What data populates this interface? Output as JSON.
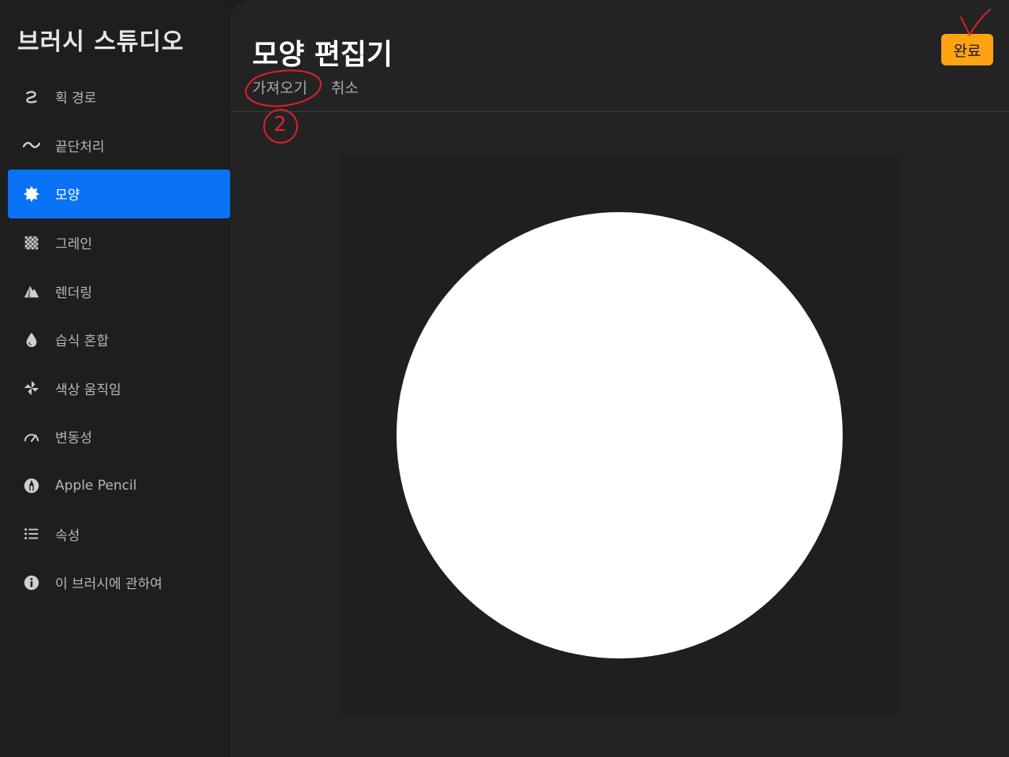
{
  "sidebar": {
    "title": "브러시 스튜디오",
    "items": [
      {
        "label": "획 경로",
        "icon": "stroke-path-icon"
      },
      {
        "label": "끝단처리",
        "icon": "taper-wave-icon"
      },
      {
        "label": "모양",
        "icon": "shape-star-icon",
        "active": true
      },
      {
        "label": "그레인",
        "icon": "grain-checker-icon"
      },
      {
        "label": "렌더링",
        "icon": "rendering-mountain-icon"
      },
      {
        "label": "습식 혼합",
        "icon": "wet-mix-drop-icon"
      },
      {
        "label": "색상 움직임",
        "icon": "color-dynamics-pinwheel-icon"
      },
      {
        "label": "변동성",
        "icon": "dynamics-gauge-icon"
      },
      {
        "label": "Apple Pencil",
        "icon": "apple-pencil-icon"
      },
      {
        "label": "속성",
        "icon": "properties-list-icon"
      },
      {
        "label": "이 브러시에 관하여",
        "icon": "info-icon"
      }
    ]
  },
  "main": {
    "title": "모양 편집기",
    "subnav": {
      "import": "가져오기",
      "cancel": "취소"
    },
    "done_label": "완료"
  },
  "annotations": {
    "step_number": "2",
    "colors": {
      "red_marker": "#e0202c"
    }
  },
  "colors": {
    "accent_blue": "#0a72f5",
    "done_orange": "#ffa313"
  }
}
